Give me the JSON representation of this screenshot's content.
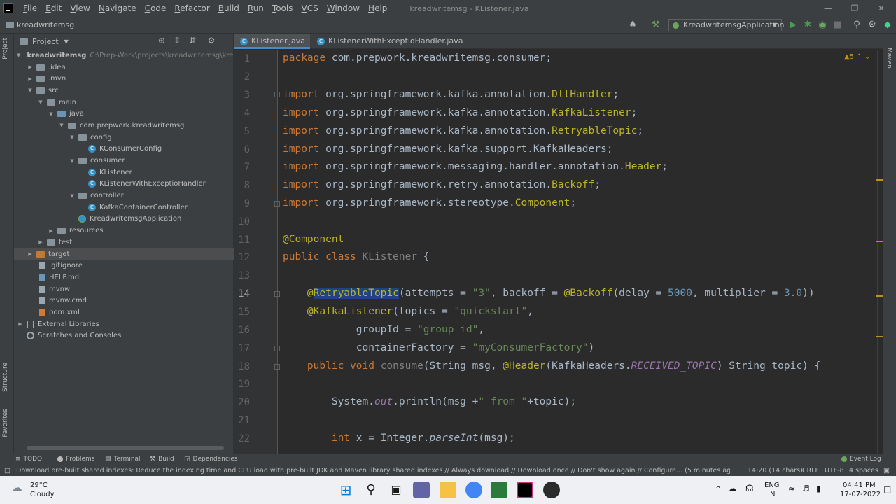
{
  "menubar": {
    "items": [
      "File",
      "Edit",
      "View",
      "Navigate",
      "Code",
      "Refactor",
      "Build",
      "Run",
      "Tools",
      "VCS",
      "Window",
      "Help"
    ],
    "window_title": "kreadwritemsg - KListener.java"
  },
  "navbar": {
    "breadcrumb": "kreadwritemsg",
    "run_config": "KreadwritemsgApplication"
  },
  "project_panel": {
    "title": "Project",
    "tree": [
      {
        "label": "kreadwritemsg",
        "path": "C:\\Prep-Work\\projects\\kreadwritemsg\\kreadwr",
        "icon": "folder"
      },
      {
        "label": ".idea",
        "icon": "folder"
      },
      {
        "label": ".mvn",
        "icon": "folder"
      },
      {
        "label": "src",
        "icon": "folder"
      },
      {
        "label": "main",
        "icon": "folder"
      },
      {
        "label": "java",
        "icon": "folder-source"
      },
      {
        "label": "com.prepwork.kreadwritemsg",
        "icon": "package"
      },
      {
        "label": "config",
        "icon": "package"
      },
      {
        "label": "KConsumerConfig",
        "icon": "class"
      },
      {
        "label": "consumer",
        "icon": "package"
      },
      {
        "label": "KListener",
        "icon": "class"
      },
      {
        "label": "KListenerWithExceptioHandler",
        "icon": "class"
      },
      {
        "label": "controller",
        "icon": "package"
      },
      {
        "label": "KafkaContainerController",
        "icon": "class"
      },
      {
        "label": "KreadwritemsgApplication",
        "icon": "spring-app"
      },
      {
        "label": "resources",
        "icon": "folder-resources"
      },
      {
        "label": "test",
        "icon": "folder"
      },
      {
        "label": "target",
        "icon": "folder-excluded"
      },
      {
        "label": ".gitignore",
        "icon": "file"
      },
      {
        "label": "HELP.md",
        "icon": "markdown-file"
      },
      {
        "label": "mvnw",
        "icon": "file"
      },
      {
        "label": "mvnw.cmd",
        "icon": "file"
      },
      {
        "label": "pom.xml",
        "icon": "maven-file"
      },
      {
        "label": "External Libraries",
        "icon": "library"
      },
      {
        "label": "Scratches and Consoles",
        "icon": "scratch"
      }
    ]
  },
  "editor": {
    "tabs": [
      {
        "label": "KListener.java",
        "active": true
      },
      {
        "label": "KListenerWithExceptioHandler.java",
        "active": false
      }
    ],
    "warning_count": "5",
    "line_numbers": [
      "1",
      "2",
      "3",
      "4",
      "5",
      "6",
      "7",
      "8",
      "9",
      "10",
      "11",
      "12",
      "13",
      "14",
      "15",
      "16",
      "17",
      "18",
      "19",
      "20",
      "21",
      "22"
    ],
    "current_line": "14"
  },
  "left_stripe": {
    "project": "Project",
    "structure": "Structure",
    "favorites": "Favorites"
  },
  "right_stripe": {
    "maven": "Maven"
  },
  "tool_tabs": {
    "todo": "TODO",
    "problems": "Problems",
    "terminal": "Terminal",
    "build": "Build",
    "dependencies": "Dependencies",
    "event_log": "Event Log"
  },
  "statusbar": {
    "message": "Download pre-built shared indexes: Reduce the indexing time and CPU load with pre-built JDK and Maven library shared indexes // Always download // Download once // Don't show again // Configure... (5 minutes ago)",
    "position": "14:20 (14 chars)",
    "line_sep": "CRLF",
    "encoding": "UTF-8",
    "indent": "4 spaces"
  },
  "taskbar": {
    "weather_temp": "29°C",
    "weather_desc": "Cloudy",
    "lang1": "ENG",
    "lang2": "IN",
    "time": "04:41 PM",
    "date": "17-07-2022"
  },
  "colors": {
    "keyword": "#cc7832",
    "annotation": "#bbb529",
    "string": "#6a8759",
    "number": "#6897bb",
    "selection": "#214283"
  }
}
